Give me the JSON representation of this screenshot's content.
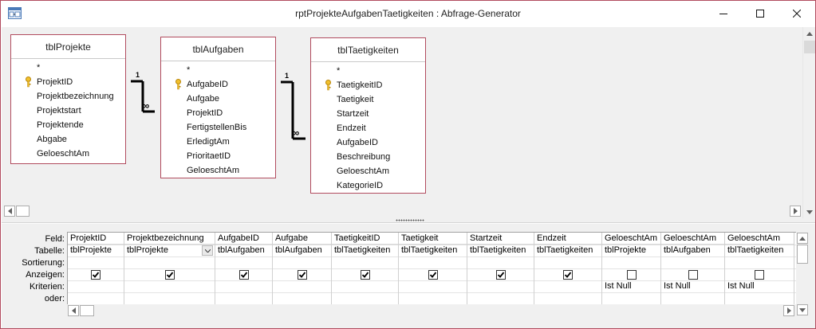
{
  "window": {
    "title": "rptProjekteAufgabenTaetigkeiten : Abfrage-Generator",
    "border_color": "#b14b5e",
    "minimize_icon": "minimize-icon",
    "maximize_icon": "maximize-icon",
    "close_icon": "close-icon"
  },
  "tables": [
    {
      "name": "tblProjekte",
      "fields": [
        "*",
        "ProjektID",
        "Projektbezeichnung",
        "Projektstart",
        "Projektende",
        "Abgabe",
        "GeloeschtAm"
      ],
      "primary_key": "ProjektID"
    },
    {
      "name": "tblAufgaben",
      "fields": [
        "*",
        "AufgabeID",
        "Aufgabe",
        "ProjektID",
        "FertigstellenBis",
        "ErledigtAm",
        "PrioritaetID",
        "GeloeschtAm"
      ],
      "primary_key": "AufgabeID"
    },
    {
      "name": "tblTaetigkeiten",
      "fields": [
        "*",
        "TaetigkeitID",
        "Taetigkeit",
        "Startzeit",
        "Endzeit",
        "AufgabeID",
        "Beschreibung",
        "GeloeschtAm",
        "KategorieID"
      ],
      "primary_key": "TaetigkeitID"
    }
  ],
  "relationships": [
    {
      "one_side": "1",
      "many_side": "∞"
    },
    {
      "one_side": "1",
      "many_side": "∞"
    }
  ],
  "grid": {
    "row_labels": [
      "Feld:",
      "Tabelle:",
      "Sortierung:",
      "Anzeigen:",
      "Kriterien:",
      "oder:"
    ],
    "columns": [
      {
        "field": "ProjektID",
        "table": "tblProjekte",
        "show": true,
        "criteria": ""
      },
      {
        "field": "Projektbezeichnung",
        "table": "tblProjekte",
        "show": true,
        "criteria": ""
      },
      {
        "field": "AufgabeID",
        "table": "tblAufgaben",
        "show": true,
        "criteria": ""
      },
      {
        "field": "Aufgabe",
        "table": "tblAufgaben",
        "show": true,
        "criteria": ""
      },
      {
        "field": "TaetigkeitID",
        "table": "tblTaetigkeiten",
        "show": true,
        "criteria": ""
      },
      {
        "field": "Taetigkeit",
        "table": "tblTaetigkeiten",
        "show": true,
        "criteria": ""
      },
      {
        "field": "Startzeit",
        "table": "tblTaetigkeiten",
        "show": true,
        "criteria": ""
      },
      {
        "field": "Endzeit",
        "table": "tblTaetigkeiten",
        "show": true,
        "criteria": ""
      },
      {
        "field": "GeloeschtAm",
        "table": "tblProjekte",
        "show": false,
        "criteria": "Ist Null"
      },
      {
        "field": "GeloeschtAm",
        "table": "tblAufgaben",
        "show": false,
        "criteria": "Ist Null"
      },
      {
        "field": "GeloeschtAm",
        "table": "tblTaetigkeiten",
        "show": false,
        "criteria": "Ist Null"
      }
    ]
  }
}
